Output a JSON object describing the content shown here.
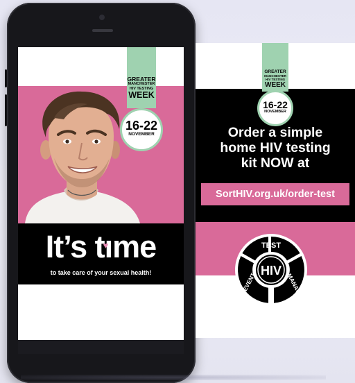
{
  "badge": {
    "line1": "GREATER",
    "line2": "MANCHESTER",
    "line3": "HIV TESTING",
    "line4": "WEEK",
    "dates": "16-22",
    "month": "NOVEMBER"
  },
  "phone_ad": {
    "headline_part1": "It’s t",
    "headline_part2": "me",
    "heart": "♥",
    "tagline": "to take care of your sexual health!"
  },
  "poster": {
    "order_line1": "Order a simple",
    "order_line2": "home HIV testing",
    "order_line3": "kit NOW at",
    "url": "SortHIV.org.uk/order-test",
    "its_time": "It’s time"
  },
  "logo": {
    "center": "HIV",
    "top": "TEST",
    "right": "MANAGE",
    "left": "PREVENT"
  },
  "colors": {
    "pink": "#d96a99",
    "green": "#9fd2b0",
    "black": "#000000",
    "white": "#ffffff"
  }
}
